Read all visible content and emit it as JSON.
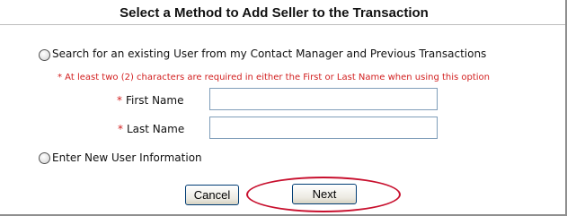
{
  "dialog": {
    "title": "Select a Method to Add Seller to the Transaction"
  },
  "options": {
    "search": {
      "label": "Search for an existing User from my Contact Manager and Previous Transactions",
      "note": "* At least two (2) characters are required in either the First or Last Name when using this option",
      "selected": false
    },
    "new_user": {
      "label": "Enter New User Information",
      "selected": false
    }
  },
  "fields": {
    "required_marker": "*",
    "first_name": {
      "label": "First Name",
      "value": ""
    },
    "last_name": {
      "label": "Last Name",
      "value": ""
    }
  },
  "buttons": {
    "cancel": "Cancel",
    "next": "Next"
  },
  "colors": {
    "required_red": "#d21f1f",
    "highlight_ellipse": "#c8102e",
    "button_border": "#003c74"
  }
}
